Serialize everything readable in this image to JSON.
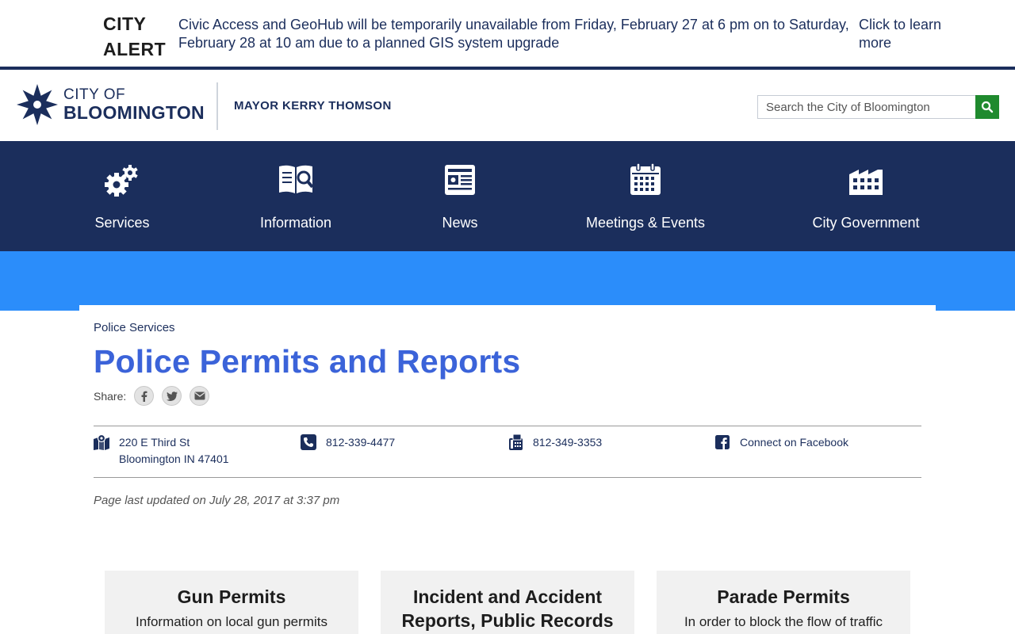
{
  "alert": {
    "title_line1": "CITY",
    "title_line2": "ALERT",
    "message": "Civic Access and GeoHub will be temporarily unavailable from Friday, February 27 at 6 pm on to Saturday, February 28 at 10 am due to a planned GIS system upgrade",
    "link": "Click to learn more"
  },
  "header": {
    "logo_line1": "CITY OF",
    "logo_line2": "BLOOMINGTON",
    "mayor": "MAYOR KERRY THOMSON",
    "search_placeholder": "Search the City of Bloomington"
  },
  "nav": {
    "items": [
      {
        "label": "Services",
        "icon": "gears-icon"
      },
      {
        "label": "Information",
        "icon": "book-search-icon"
      },
      {
        "label": "News",
        "icon": "newspaper-icon"
      },
      {
        "label": "Meetings & Events",
        "icon": "calendar-icon"
      },
      {
        "label": "City Government",
        "icon": "building-icon"
      }
    ]
  },
  "page": {
    "breadcrumb": "Police Services",
    "title": "Police Permits and Reports",
    "share_label": "Share:",
    "contact": {
      "address_line1": "220 E Third St",
      "address_line2": "Bloomington IN 47401",
      "phone": "812-339-4477",
      "fax": "812-349-3353",
      "facebook": "Connect on Facebook"
    },
    "updated": "Page last updated on July 28, 2017 at 3:37 pm",
    "cards": [
      {
        "title": "Gun Permits",
        "desc": "Information on local gun permits"
      },
      {
        "title": "Incident and Accident Reports, Public Records",
        "desc": ""
      },
      {
        "title": "Parade Permits",
        "desc": "In order to block the flow of traffic"
      }
    ]
  },
  "colors": {
    "navy": "#1b2e5c",
    "title_blue": "#3b63d9",
    "band_blue": "#2b8dfa",
    "search_green": "#1f8a2e"
  }
}
